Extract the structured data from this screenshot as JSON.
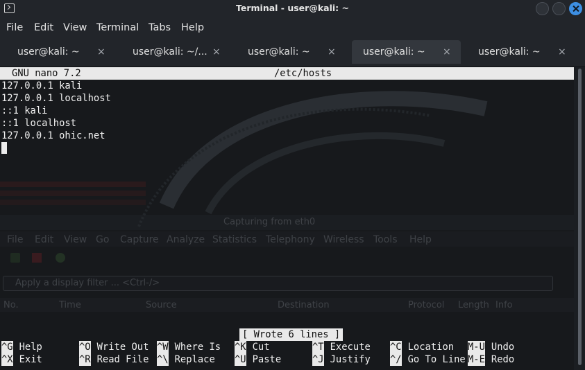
{
  "window": {
    "title": "Terminal - user@kali: ~"
  },
  "menu": [
    "File",
    "Edit",
    "View",
    "Terminal",
    "Tabs",
    "Help"
  ],
  "tabs": [
    {
      "label": "user@kali: ~",
      "active": false
    },
    {
      "label": "user@kali: ~/...",
      "active": false
    },
    {
      "label": "user@kali: ~",
      "active": false
    },
    {
      "label": "user@kali: ~",
      "active": true
    },
    {
      "label": "user@kali: ~",
      "active": false
    }
  ],
  "tab_close_glyph": "×",
  "nano": {
    "version": "GNU nano 7.2",
    "filename": "/etc/hosts",
    "lines": [
      "127.0.0.1 kali",
      "127.0.0.1 localhost",
      "::1 kali",
      "::1 localhost",
      "127.0.0.1 ohic.net"
    ],
    "status": "[ Wrote 6 lines ]",
    "shortcuts_row1": [
      {
        "key": "^G",
        "label": "Help"
      },
      {
        "key": "^O",
        "label": "Write Out"
      },
      {
        "key": "^W",
        "label": "Where Is"
      },
      {
        "key": "^K",
        "label": "Cut"
      },
      {
        "key": "^T",
        "label": "Execute"
      },
      {
        "key": "^C",
        "label": "Location"
      },
      {
        "key": "M-U",
        "label": "Undo"
      }
    ],
    "shortcuts_row2": [
      {
        "key": "^X",
        "label": "Exit"
      },
      {
        "key": "^R",
        "label": "Read File"
      },
      {
        "key": "^\\",
        "label": "Replace"
      },
      {
        "key": "^U",
        "label": "Paste"
      },
      {
        "key": "^J",
        "label": "Justify"
      },
      {
        "key": "^/",
        "label": "Go To Line"
      },
      {
        "key": "M-E",
        "label": "Redo"
      }
    ]
  },
  "background_window": {
    "title": "Capturing from eth0",
    "menu": [
      "File",
      "Edit",
      "View",
      "Go",
      "Capture",
      "Analyze",
      "Statistics",
      "Telephony",
      "Wireless",
      "Tools",
      "Help"
    ],
    "filter_placeholder": "Apply a display filter ... <Ctrl-/>",
    "columns": [
      "No.",
      "Time",
      "Source",
      "Destination",
      "Protocol",
      "Length",
      "Info"
    ]
  },
  "colors": {
    "terminal_bg": "#17191c",
    "chrome_bg": "#22252a",
    "nano_bar": "#e9e9e9",
    "close_button": "#3d8fe3"
  }
}
